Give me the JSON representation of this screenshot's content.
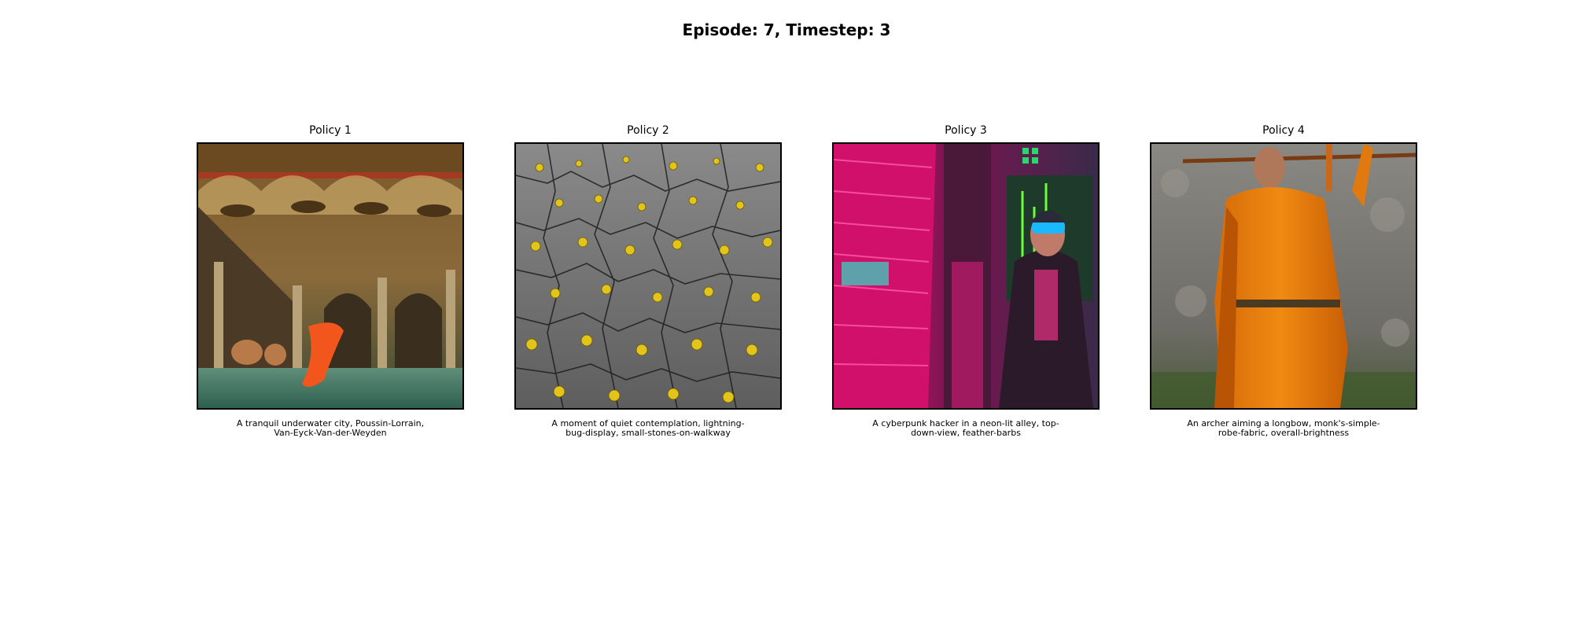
{
  "figure": {
    "title": "Episode: 7, Timestep: 3"
  },
  "panels": [
    {
      "title": "Policy 1",
      "caption": "A tranquil underwater city, Poussin-Lorrain, Van-Eyck-Van-der-Weyden",
      "image_icon": "renaissance-flooded-hall-image"
    },
    {
      "title": "Policy 2",
      "caption": "A moment of quiet contemplation, lightning-bug-display, small-stones-on-walkway",
      "image_icon": "cracked-stone-yellow-dots-image"
    },
    {
      "title": "Policy 3",
      "caption": "A cyberpunk hacker in a neon-lit alley, top-down-view, feather-barbs",
      "image_icon": "neon-cyberpunk-hacker-image"
    },
    {
      "title": "Policy 4",
      "caption": "An archer aiming a longbow, monk's-simple-robe-fabric, overall-brightness",
      "image_icon": "orange-robed-monk-archer-image"
    }
  ]
}
